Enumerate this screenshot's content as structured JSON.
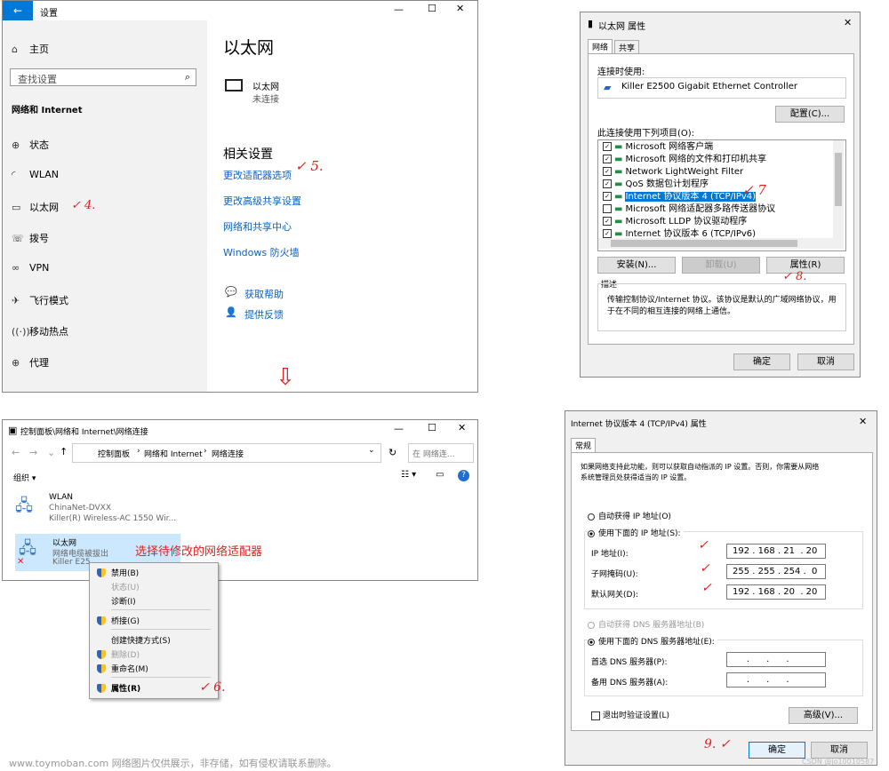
{
  "settings": {
    "window_title": "设置",
    "home": "主页",
    "search_placeholder": "查找设置",
    "section": "网络和 Internet",
    "nav": [
      {
        "icon": "status-icon",
        "glyph": "⊕",
        "label": "状态"
      },
      {
        "icon": "wifi-icon",
        "glyph": "◜",
        "label": "WLAN"
      },
      {
        "icon": "ethernet-icon",
        "glyph": "▭",
        "label": "以太网"
      },
      {
        "icon": "dialup-icon",
        "glyph": "☏",
        "label": "拨号"
      },
      {
        "icon": "vpn-icon",
        "glyph": "∞",
        "label": "VPN"
      },
      {
        "icon": "airplane-icon",
        "glyph": "✈",
        "label": "飞行模式"
      },
      {
        "icon": "hotspot-icon",
        "glyph": "((·))",
        "label": "移动热点"
      },
      {
        "icon": "proxy-icon",
        "glyph": "⊕",
        "label": "代理"
      }
    ],
    "page_title": "以太网",
    "adapter_name": "以太网",
    "adapter_status": "未连接",
    "related_title": "相关设置",
    "links": [
      "更改适配器选项",
      "更改高级共享设置",
      "网络和共享中心",
      "Windows 防火墙"
    ],
    "help": "获取帮助",
    "feedback": "提供反馈"
  },
  "marks": {
    "m4": "✓ 4.",
    "m5": "✓ 5.",
    "m6": "✓ 6.",
    "m7": "✓ 7",
    "m8": "✓ 8.",
    "m9": "9. ✓",
    "annot": "选择待修改的网络适配器"
  },
  "props": {
    "title": "以太网 属性",
    "tabs": [
      "网络",
      "共享"
    ],
    "connect_using": "连接时使用:",
    "device": "Killer E2500 Gigabit Ethernet Controller",
    "configure": "配置(C)...",
    "items_label": "此连接使用下列项目(O):",
    "items": [
      {
        "checked": true,
        "label": "Microsoft 网络客户端"
      },
      {
        "checked": true,
        "label": "Microsoft 网络的文件和打印机共享"
      },
      {
        "checked": true,
        "label": "Network LightWeight Filter"
      },
      {
        "checked": true,
        "label": "QoS 数据包计划程序"
      },
      {
        "checked": true,
        "label": "Internet 协议版本 4 (TCP/IPv4)",
        "selected": true
      },
      {
        "checked": false,
        "label": "Microsoft 网络适配器多路传送器协议"
      },
      {
        "checked": true,
        "label": "Microsoft LLDP 协议驱动程序"
      },
      {
        "checked": true,
        "label": "Internet 协议版本 6 (TCP/IPv6)"
      }
    ],
    "install": "安装(N)...",
    "uninstall": "卸载(U)",
    "properties": "属性(R)",
    "desc_title": "描述",
    "desc_line1": "传输控制协议/Internet 协议。该协议是默认的广域网络协议，用",
    "desc_line2": "于在不同的相互连接的网络上通信。",
    "ok": "确定",
    "cancel": "取消"
  },
  "netconn": {
    "title": "控制面板\\网络和 Internet\\网络连接",
    "crumbs": [
      "控制面板",
      "网络和 Internet",
      "网络连接"
    ],
    "search_placeholder": "在 网络连...",
    "organize": "组织 ▾",
    "wlan": {
      "name": "WLAN",
      "sub1": "ChinaNet-DVXX",
      "sub2": "Killer(R) Wireless-AC 1550 Wir..."
    },
    "eth": {
      "name": "以太网",
      "sub1": "网络电缆被拔出",
      "sub2": "Killer E25"
    }
  },
  "menu": {
    "items": [
      {
        "label": "禁用(B)",
        "shield": true
      },
      {
        "label": "状态(U)",
        "disabled": true
      },
      {
        "label": "诊断(I)"
      },
      {
        "label": "桥接(G)",
        "shield": true
      },
      {
        "label": "创建快捷方式(S)"
      },
      {
        "label": "删除(D)",
        "shield": true,
        "disabled": true
      },
      {
        "label": "重命名(M)",
        "shield": true
      },
      {
        "label": "属性(R)",
        "shield": true,
        "selected": true
      }
    ]
  },
  "ipv4": {
    "title": "Internet 协议版本 4 (TCP/IPv4) 属性",
    "tab": "常规",
    "intro1": "如果网络支持此功能，则可以获取自动指派的 IP 设置。否则，你需要从网络",
    "intro2": "系统管理员处获得适当的 IP 设置。",
    "auto_ip": "自动获得 IP 地址(O)",
    "manual_ip": "使用下面的 IP 地址(S):",
    "ip_label": "IP 地址(I):",
    "ip": "192 . 168 . 21  . 20",
    "mask_label": "子网掩码(U):",
    "mask": "255 . 255 . 254 .  0",
    "gw_label": "默认网关(D):",
    "gw": "192 . 168 . 20  . 20",
    "auto_dns": "自动获得 DNS 服务器地址(B)",
    "manual_dns": "使用下面的 DNS 服务器地址(E):",
    "dns1_label": "首选 DNS 服务器(P):",
    "dns2_label": "备用 DNS 服务器(A):",
    "dns_blank": "     .      .      .",
    "validate": "退出时验证设置(L)",
    "advanced": "高级(V)...",
    "ok": "确定",
    "cancel": "取消"
  },
  "footer": {
    "watermark": "www.toymoban.com 网络图片仅供展示，非存储，如有侵权请联系删除。",
    "credit": "CSDN @jo10010587"
  }
}
